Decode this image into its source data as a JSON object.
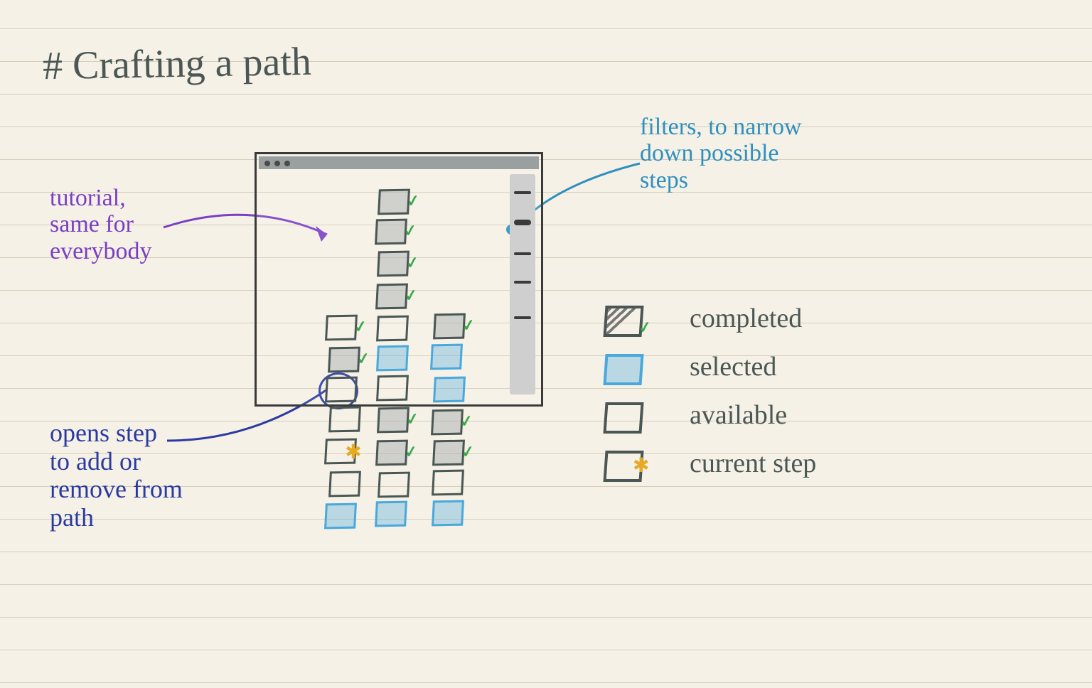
{
  "title": "# Crafting a path",
  "annotations": {
    "tutorial": "tutorial,\nsame for\neverybody",
    "filters": "filters, to narrow\ndown possible\nsteps",
    "opens": "opens step\nto add or\nremove from\npath"
  },
  "legend": {
    "completed": "completed",
    "selected": "selected",
    "available": "available",
    "current": "current step"
  },
  "colors": {
    "paper": "#f5f1e6",
    "rule": "#d6ceb8",
    "ink": "#4a5754",
    "purple": "#7a3fc4",
    "skyblue": "#2f8fbf",
    "navyblue": "#2a3aa0",
    "green": "#3ba84a",
    "gold": "#e7a923",
    "selectblue": "#4aa8dc"
  },
  "window": {
    "sidebar_items": 5,
    "steps": [
      {
        "col": 1,
        "row": 0,
        "type": "completed",
        "check": true
      },
      {
        "col": 1,
        "row": 1,
        "type": "completed",
        "check": true
      },
      {
        "col": 1,
        "row": 2,
        "type": "completed",
        "check": true
      },
      {
        "col": 1,
        "row": 3,
        "type": "completed",
        "check": true
      },
      {
        "col": 0,
        "row": 4,
        "type": "available",
        "check": true
      },
      {
        "col": 1,
        "row": 4,
        "type": "available",
        "check": false
      },
      {
        "col": 2,
        "row": 4,
        "type": "completed",
        "check": true
      },
      {
        "col": 0,
        "row": 5,
        "type": "completed",
        "check": true
      },
      {
        "col": 1,
        "row": 5,
        "type": "selected",
        "check": false
      },
      {
        "col": 2,
        "row": 5,
        "type": "selected",
        "check": false
      },
      {
        "col": 0,
        "row": 6,
        "type": "available",
        "check": false,
        "highlight": true
      },
      {
        "col": 1,
        "row": 6,
        "type": "available",
        "check": false
      },
      {
        "col": 2,
        "row": 6,
        "type": "selected",
        "check": false
      },
      {
        "col": 0,
        "row": 7,
        "type": "available",
        "check": false
      },
      {
        "col": 1,
        "row": 7,
        "type": "completed",
        "check": true
      },
      {
        "col": 2,
        "row": 7,
        "type": "completed",
        "check": true
      },
      {
        "col": 0,
        "row": 8,
        "type": "current",
        "check": false
      },
      {
        "col": 1,
        "row": 8,
        "type": "completed",
        "check": true
      },
      {
        "col": 2,
        "row": 8,
        "type": "completed",
        "check": true
      },
      {
        "col": 0,
        "row": 9,
        "type": "available",
        "check": false
      },
      {
        "col": 1,
        "row": 9,
        "type": "available",
        "check": false
      },
      {
        "col": 2,
        "row": 9,
        "type": "available",
        "check": false
      },
      {
        "col": 0,
        "row": 10,
        "type": "selected",
        "check": false
      },
      {
        "col": 1,
        "row": 10,
        "type": "selected",
        "check": false
      },
      {
        "col": 2,
        "row": 10,
        "type": "selected",
        "check": false
      }
    ]
  }
}
